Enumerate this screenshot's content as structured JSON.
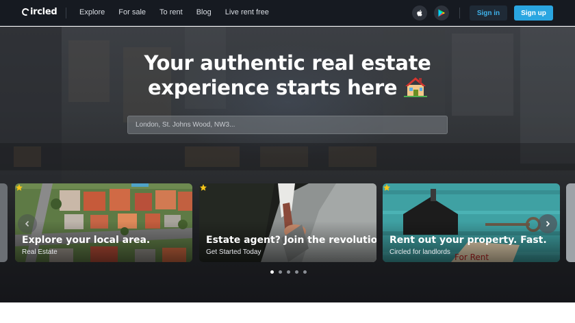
{
  "brand": {
    "name": "ircled"
  },
  "nav": {
    "links": [
      "Explore",
      "For sale",
      "To rent",
      "Blog",
      "Live rent free"
    ],
    "apple_icon": "apple-icon",
    "play_icon": "google-play-icon",
    "signin_label": "Sign in",
    "signup_label": "Sign up"
  },
  "hero": {
    "title_line1": "Your authentic real estate",
    "title_line2": "experience starts here",
    "search_placeholder": "London, St. Johns Wood, NW3..."
  },
  "cards": [
    {
      "title": "Explore your local area.",
      "subtitle": "Real Estate",
      "star_icon": "star-icon"
    },
    {
      "title": "Estate agent? Join the revolution!",
      "subtitle": "Get Started Today",
      "star_icon": "star-icon"
    },
    {
      "title": "Rent out your property. Fast.",
      "subtitle": "Circled for landlords",
      "star_icon": "star-icon"
    }
  ],
  "carousel": {
    "slide_count": 5,
    "active_slide": 1
  },
  "colors": {
    "nav_bg": "#161a21",
    "accent": "#2aa6e1",
    "star": "#f5c518"
  }
}
